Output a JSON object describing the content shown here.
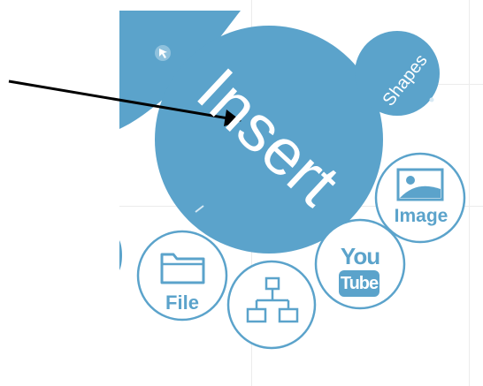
{
  "insert_menu": {
    "center_label": "Insert",
    "shapes_label": "Shapes",
    "file_label": "File",
    "image_label": "Image",
    "youtube_top": "You",
    "youtube_bottom": "Tube"
  },
  "colors": {
    "menu_blue": "#5ba3cb",
    "icon_border": "#5ba3cb",
    "arrow": "#000000",
    "background": "#ffffff"
  },
  "icons": [
    "cursor-icon",
    "folder-icon",
    "diagram-icon",
    "youtube-icon",
    "image-icon",
    "arrow-annotation"
  ]
}
